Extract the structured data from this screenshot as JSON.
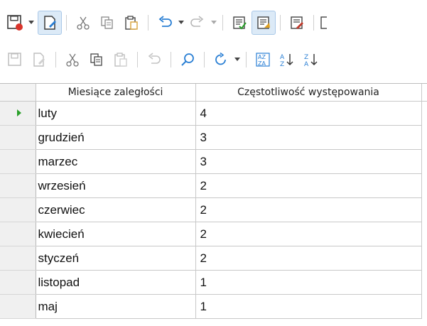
{
  "toolbar_primary": {
    "icons": [
      "save-icon",
      "dropdown-arrow",
      "edit-document-icon",
      "cut-icon",
      "copy-icon",
      "paste-icon",
      "undo-icon",
      "dropdown-arrow",
      "redo-icon",
      "dropdown-arrow",
      "form-check-icon",
      "design-mode-icon",
      "edit-form-icon",
      "more-icon"
    ]
  },
  "toolbar_secondary": {
    "icons": [
      "save-record-icon",
      "edit-record-icon",
      "cut-icon",
      "copy-icon",
      "paste-icon",
      "undo-icon",
      "find-record-icon",
      "refresh-icon",
      "dropdown-arrow",
      "sort-icon",
      "sort-ascending-icon",
      "sort-descending-icon"
    ]
  },
  "table": {
    "columns": [
      "Miesiące zaległości",
      "Częstotliwość występowania"
    ],
    "rows": [
      {
        "month": "luty",
        "count": "4"
      },
      {
        "month": "grudzień",
        "count": "3"
      },
      {
        "month": "marzec",
        "count": "3"
      },
      {
        "month": "wrzesień",
        "count": "2"
      },
      {
        "month": "czerwiec",
        "count": "2"
      },
      {
        "month": "kwiecień",
        "count": "2"
      },
      {
        "month": "styczeń",
        "count": "2"
      },
      {
        "month": "listopad",
        "count": "1"
      },
      {
        "month": "maj",
        "count": "1"
      }
    ],
    "current_row_index": 0
  },
  "colors": {
    "accent": "#2a7fd4",
    "current_row_marker": "#2aa02a",
    "save_red": "#d9342b"
  }
}
